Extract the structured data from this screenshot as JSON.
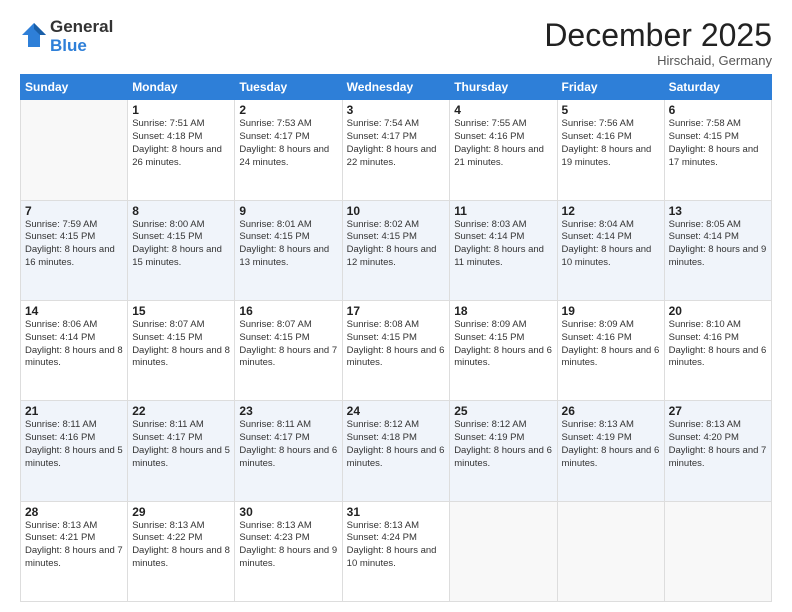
{
  "logo": {
    "general": "General",
    "blue": "Blue"
  },
  "header": {
    "month": "December 2025",
    "location": "Hirschaid, Germany"
  },
  "weekdays": [
    "Sunday",
    "Monday",
    "Tuesday",
    "Wednesday",
    "Thursday",
    "Friday",
    "Saturday"
  ],
  "weeks": [
    [
      {
        "day": "",
        "empty": true
      },
      {
        "day": "1",
        "sunrise": "Sunrise: 7:51 AM",
        "sunset": "Sunset: 4:18 PM",
        "daylight": "Daylight: 8 hours and 26 minutes."
      },
      {
        "day": "2",
        "sunrise": "Sunrise: 7:53 AM",
        "sunset": "Sunset: 4:17 PM",
        "daylight": "Daylight: 8 hours and 24 minutes."
      },
      {
        "day": "3",
        "sunrise": "Sunrise: 7:54 AM",
        "sunset": "Sunset: 4:17 PM",
        "daylight": "Daylight: 8 hours and 22 minutes."
      },
      {
        "day": "4",
        "sunrise": "Sunrise: 7:55 AM",
        "sunset": "Sunset: 4:16 PM",
        "daylight": "Daylight: 8 hours and 21 minutes."
      },
      {
        "day": "5",
        "sunrise": "Sunrise: 7:56 AM",
        "sunset": "Sunset: 4:16 PM",
        "daylight": "Daylight: 8 hours and 19 minutes."
      },
      {
        "day": "6",
        "sunrise": "Sunrise: 7:58 AM",
        "sunset": "Sunset: 4:15 PM",
        "daylight": "Daylight: 8 hours and 17 minutes."
      }
    ],
    [
      {
        "day": "7",
        "sunrise": "Sunrise: 7:59 AM",
        "sunset": "Sunset: 4:15 PM",
        "daylight": "Daylight: 8 hours and 16 minutes."
      },
      {
        "day": "8",
        "sunrise": "Sunrise: 8:00 AM",
        "sunset": "Sunset: 4:15 PM",
        "daylight": "Daylight: 8 hours and 15 minutes."
      },
      {
        "day": "9",
        "sunrise": "Sunrise: 8:01 AM",
        "sunset": "Sunset: 4:15 PM",
        "daylight": "Daylight: 8 hours and 13 minutes."
      },
      {
        "day": "10",
        "sunrise": "Sunrise: 8:02 AM",
        "sunset": "Sunset: 4:15 PM",
        "daylight": "Daylight: 8 hours and 12 minutes."
      },
      {
        "day": "11",
        "sunrise": "Sunrise: 8:03 AM",
        "sunset": "Sunset: 4:14 PM",
        "daylight": "Daylight: 8 hours and 11 minutes."
      },
      {
        "day": "12",
        "sunrise": "Sunrise: 8:04 AM",
        "sunset": "Sunset: 4:14 PM",
        "daylight": "Daylight: 8 hours and 10 minutes."
      },
      {
        "day": "13",
        "sunrise": "Sunrise: 8:05 AM",
        "sunset": "Sunset: 4:14 PM",
        "daylight": "Daylight: 8 hours and 9 minutes."
      }
    ],
    [
      {
        "day": "14",
        "sunrise": "Sunrise: 8:06 AM",
        "sunset": "Sunset: 4:14 PM",
        "daylight": "Daylight: 8 hours and 8 minutes."
      },
      {
        "day": "15",
        "sunrise": "Sunrise: 8:07 AM",
        "sunset": "Sunset: 4:15 PM",
        "daylight": "Daylight: 8 hours and 8 minutes."
      },
      {
        "day": "16",
        "sunrise": "Sunrise: 8:07 AM",
        "sunset": "Sunset: 4:15 PM",
        "daylight": "Daylight: 8 hours and 7 minutes."
      },
      {
        "day": "17",
        "sunrise": "Sunrise: 8:08 AM",
        "sunset": "Sunset: 4:15 PM",
        "daylight": "Daylight: 8 hours and 6 minutes."
      },
      {
        "day": "18",
        "sunrise": "Sunrise: 8:09 AM",
        "sunset": "Sunset: 4:15 PM",
        "daylight": "Daylight: 8 hours and 6 minutes."
      },
      {
        "day": "19",
        "sunrise": "Sunrise: 8:09 AM",
        "sunset": "Sunset: 4:16 PM",
        "daylight": "Daylight: 8 hours and 6 minutes."
      },
      {
        "day": "20",
        "sunrise": "Sunrise: 8:10 AM",
        "sunset": "Sunset: 4:16 PM",
        "daylight": "Daylight: 8 hours and 6 minutes."
      }
    ],
    [
      {
        "day": "21",
        "sunrise": "Sunrise: 8:11 AM",
        "sunset": "Sunset: 4:16 PM",
        "daylight": "Daylight: 8 hours and 5 minutes."
      },
      {
        "day": "22",
        "sunrise": "Sunrise: 8:11 AM",
        "sunset": "Sunset: 4:17 PM",
        "daylight": "Daylight: 8 hours and 5 minutes."
      },
      {
        "day": "23",
        "sunrise": "Sunrise: 8:11 AM",
        "sunset": "Sunset: 4:17 PM",
        "daylight": "Daylight: 8 hours and 6 minutes."
      },
      {
        "day": "24",
        "sunrise": "Sunrise: 8:12 AM",
        "sunset": "Sunset: 4:18 PM",
        "daylight": "Daylight: 8 hours and 6 minutes."
      },
      {
        "day": "25",
        "sunrise": "Sunrise: 8:12 AM",
        "sunset": "Sunset: 4:19 PM",
        "daylight": "Daylight: 8 hours and 6 minutes."
      },
      {
        "day": "26",
        "sunrise": "Sunrise: 8:13 AM",
        "sunset": "Sunset: 4:19 PM",
        "daylight": "Daylight: 8 hours and 6 minutes."
      },
      {
        "day": "27",
        "sunrise": "Sunrise: 8:13 AM",
        "sunset": "Sunset: 4:20 PM",
        "daylight": "Daylight: 8 hours and 7 minutes."
      }
    ],
    [
      {
        "day": "28",
        "sunrise": "Sunrise: 8:13 AM",
        "sunset": "Sunset: 4:21 PM",
        "daylight": "Daylight: 8 hours and 7 minutes."
      },
      {
        "day": "29",
        "sunrise": "Sunrise: 8:13 AM",
        "sunset": "Sunset: 4:22 PM",
        "daylight": "Daylight: 8 hours and 8 minutes."
      },
      {
        "day": "30",
        "sunrise": "Sunrise: 8:13 AM",
        "sunset": "Sunset: 4:23 PM",
        "daylight": "Daylight: 8 hours and 9 minutes."
      },
      {
        "day": "31",
        "sunrise": "Sunrise: 8:13 AM",
        "sunset": "Sunset: 4:24 PM",
        "daylight": "Daylight: 8 hours and 10 minutes."
      },
      {
        "day": "",
        "empty": true
      },
      {
        "day": "",
        "empty": true
      },
      {
        "day": "",
        "empty": true
      }
    ]
  ]
}
